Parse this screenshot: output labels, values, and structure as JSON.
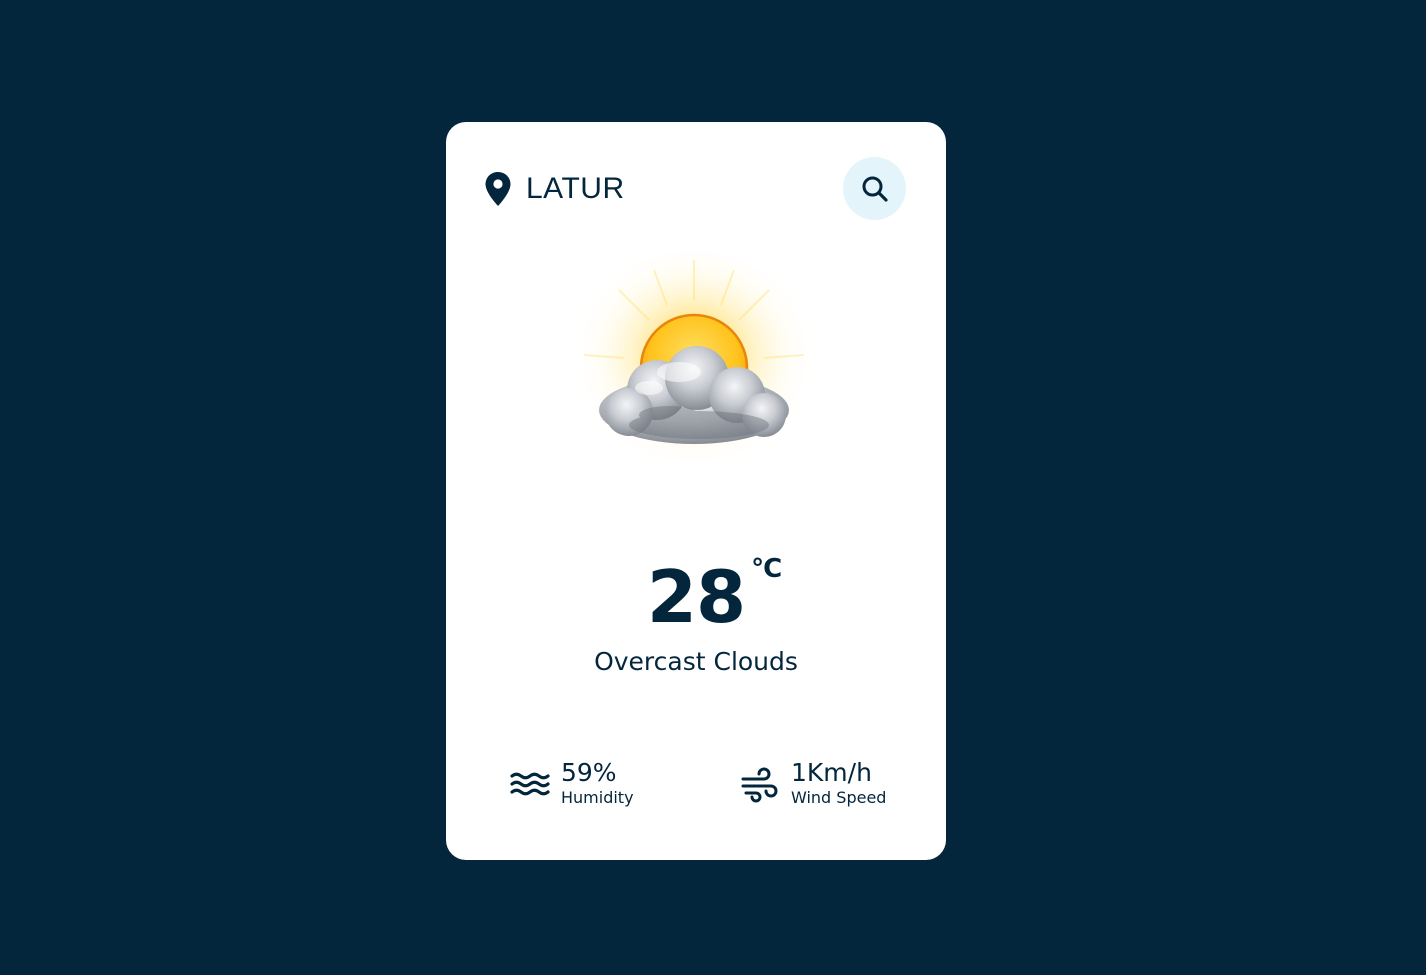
{
  "location": {
    "city": "LATUR",
    "icon": "location-pin-icon"
  },
  "search": {
    "icon": "search-icon"
  },
  "weather": {
    "icon": "sun-behind-cloud",
    "temperature": "28",
    "unit": "°C",
    "description": "Overcast Clouds"
  },
  "stats": {
    "humidity": {
      "icon": "waves-icon",
      "value": "59%",
      "label": "Humidity"
    },
    "wind": {
      "icon": "wind-icon",
      "value": "1Km/h",
      "label": "Wind Speed"
    }
  },
  "colors": {
    "background": "#04263c",
    "card": "#ffffff",
    "text": "#04263c",
    "search_button_bg": "#e3f4fb"
  }
}
